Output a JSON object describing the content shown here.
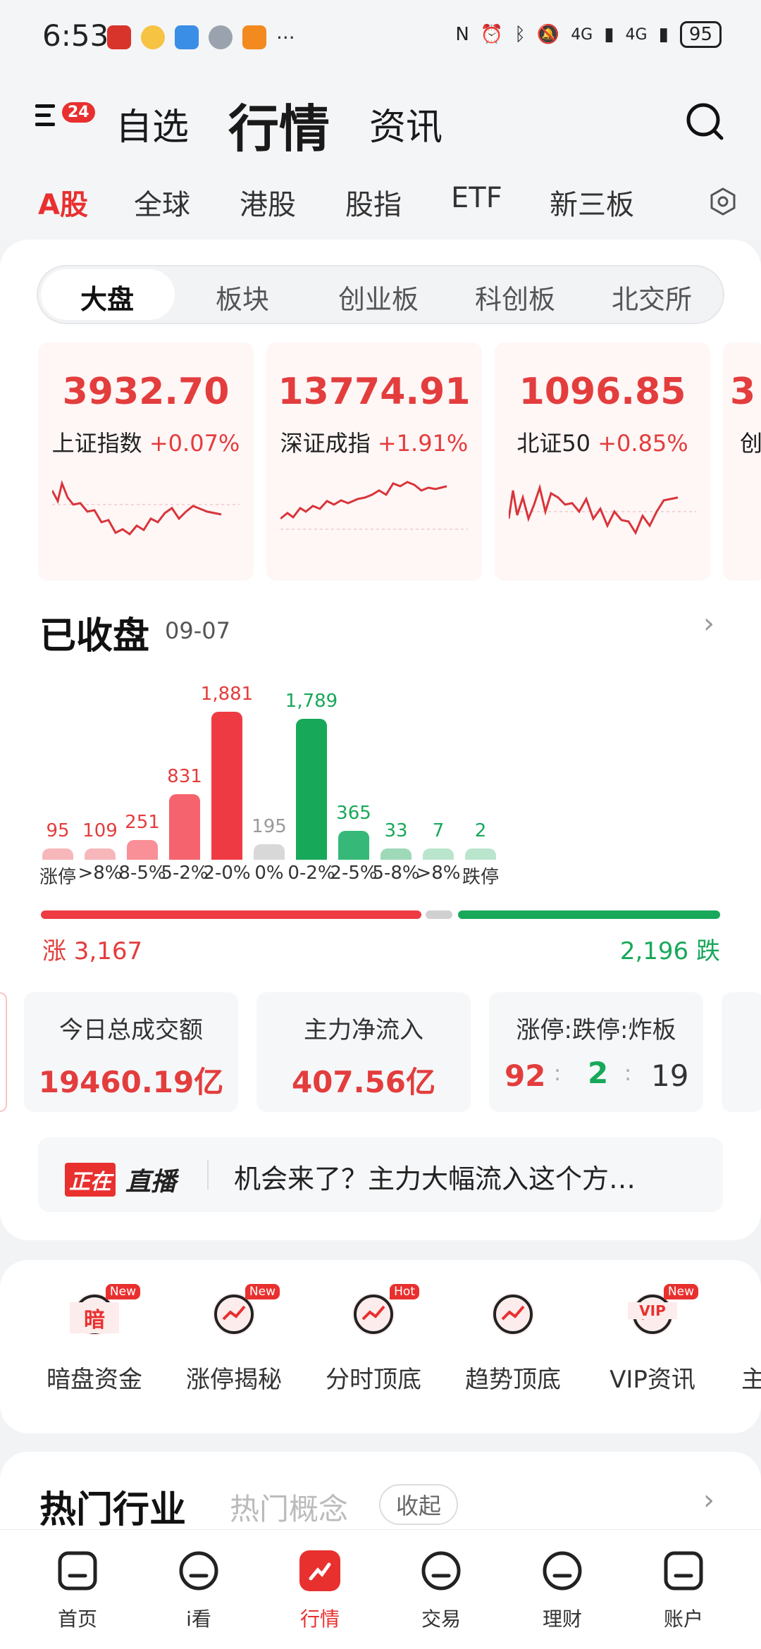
{
  "status_bar": {
    "time": "6:53",
    "more": "···",
    "battery": "95",
    "net1": "4G",
    "net2": "4G"
  },
  "header": {
    "badge": "24",
    "tabs": [
      "自选",
      "行情",
      "资讯"
    ],
    "active_tab": "行情"
  },
  "market_tabs": [
    "A股",
    "全球",
    "港股",
    "股指",
    "ETF",
    "新三板"
  ],
  "segments": [
    "大盘",
    "板块",
    "创业板",
    "科创板",
    "北交所"
  ],
  "indices": [
    {
      "value": "3932.70",
      "name": "上证指数",
      "change": "+0.07%"
    },
    {
      "value": "13774.91",
      "name": "深证成指",
      "change": "+1.91%"
    },
    {
      "value": "1096.85",
      "name": "北证50",
      "change": "+0.85%"
    },
    {
      "value": "3",
      "name": "创",
      "change": ""
    }
  ],
  "closed": {
    "title": "已收盘",
    "date": "09-07"
  },
  "distribution": {
    "labels": [
      "涨停",
      ">8%",
      "8-5%",
      "5-2%",
      "2-0%",
      "0%",
      "0-2%",
      "2-5%",
      "5-8%",
      ">8%",
      "跌停"
    ],
    "values": [
      "95",
      "109",
      "251",
      "831",
      "1,881",
      "195",
      "1,789",
      "365",
      "33",
      "7",
      "2"
    ],
    "counts": [
      95,
      109,
      251,
      831,
      1881,
      195,
      1789,
      365,
      33,
      7,
      2
    ],
    "colors": [
      "#f7b7ba",
      "#f7b7ba",
      "#f99097",
      "#f5646e",
      "#ee3b43",
      "#d8d8d8",
      "#18a85a",
      "#36b978",
      "#9ed9b8",
      "#b9e5cc",
      "#b9e5cc"
    ],
    "up_total": "涨 3,167",
    "down_total": "2,196 跌"
  },
  "stats": [
    {
      "label": "今日总成交额",
      "value": "19460.19亿"
    },
    {
      "label": "主力净流入",
      "value": "407.56亿"
    },
    {
      "label": "涨停:跌停:炸板",
      "v1": "92",
      "v2": "2",
      "v3": "19",
      "colon": ":"
    }
  ],
  "live": {
    "tag1": "正在",
    "tag2": "直播",
    "text": "机会来了？主力大幅流入这个方…"
  },
  "tools": [
    {
      "label": "暗盘资金",
      "badge": "New",
      "icon": "dark-pool-icon",
      "glyph": "暗"
    },
    {
      "label": "涨停揭秘",
      "badge": "New",
      "icon": "limit-up-icon",
      "glyph": ""
    },
    {
      "label": "分时顶底",
      "badge": "Hot",
      "icon": "intraday-icon",
      "glyph": ""
    },
    {
      "label": "趋势顶底",
      "badge": "",
      "icon": "trend-icon",
      "glyph": ""
    },
    {
      "label": "VIP资讯",
      "badge": "New",
      "icon": "vip-icon",
      "glyph": "VIP"
    },
    {
      "label": "主",
      "badge": "",
      "icon": "more-tool-icon",
      "glyph": ""
    }
  ],
  "hot": {
    "title": "热门行业",
    "concept": "热门概念",
    "collapse": "收起"
  },
  "nav": [
    {
      "label": "首页",
      "icon": "home-icon"
    },
    {
      "label": "i看",
      "icon": "play-icon"
    },
    {
      "label": "行情",
      "icon": "market-icon"
    },
    {
      "label": "交易",
      "icon": "trade-icon"
    },
    {
      "label": "理财",
      "icon": "wealth-icon"
    },
    {
      "label": "账户",
      "icon": "account-icon"
    }
  ],
  "active_nav": "行情",
  "accent": "#e8302f",
  "down_color": "#18a85a"
}
